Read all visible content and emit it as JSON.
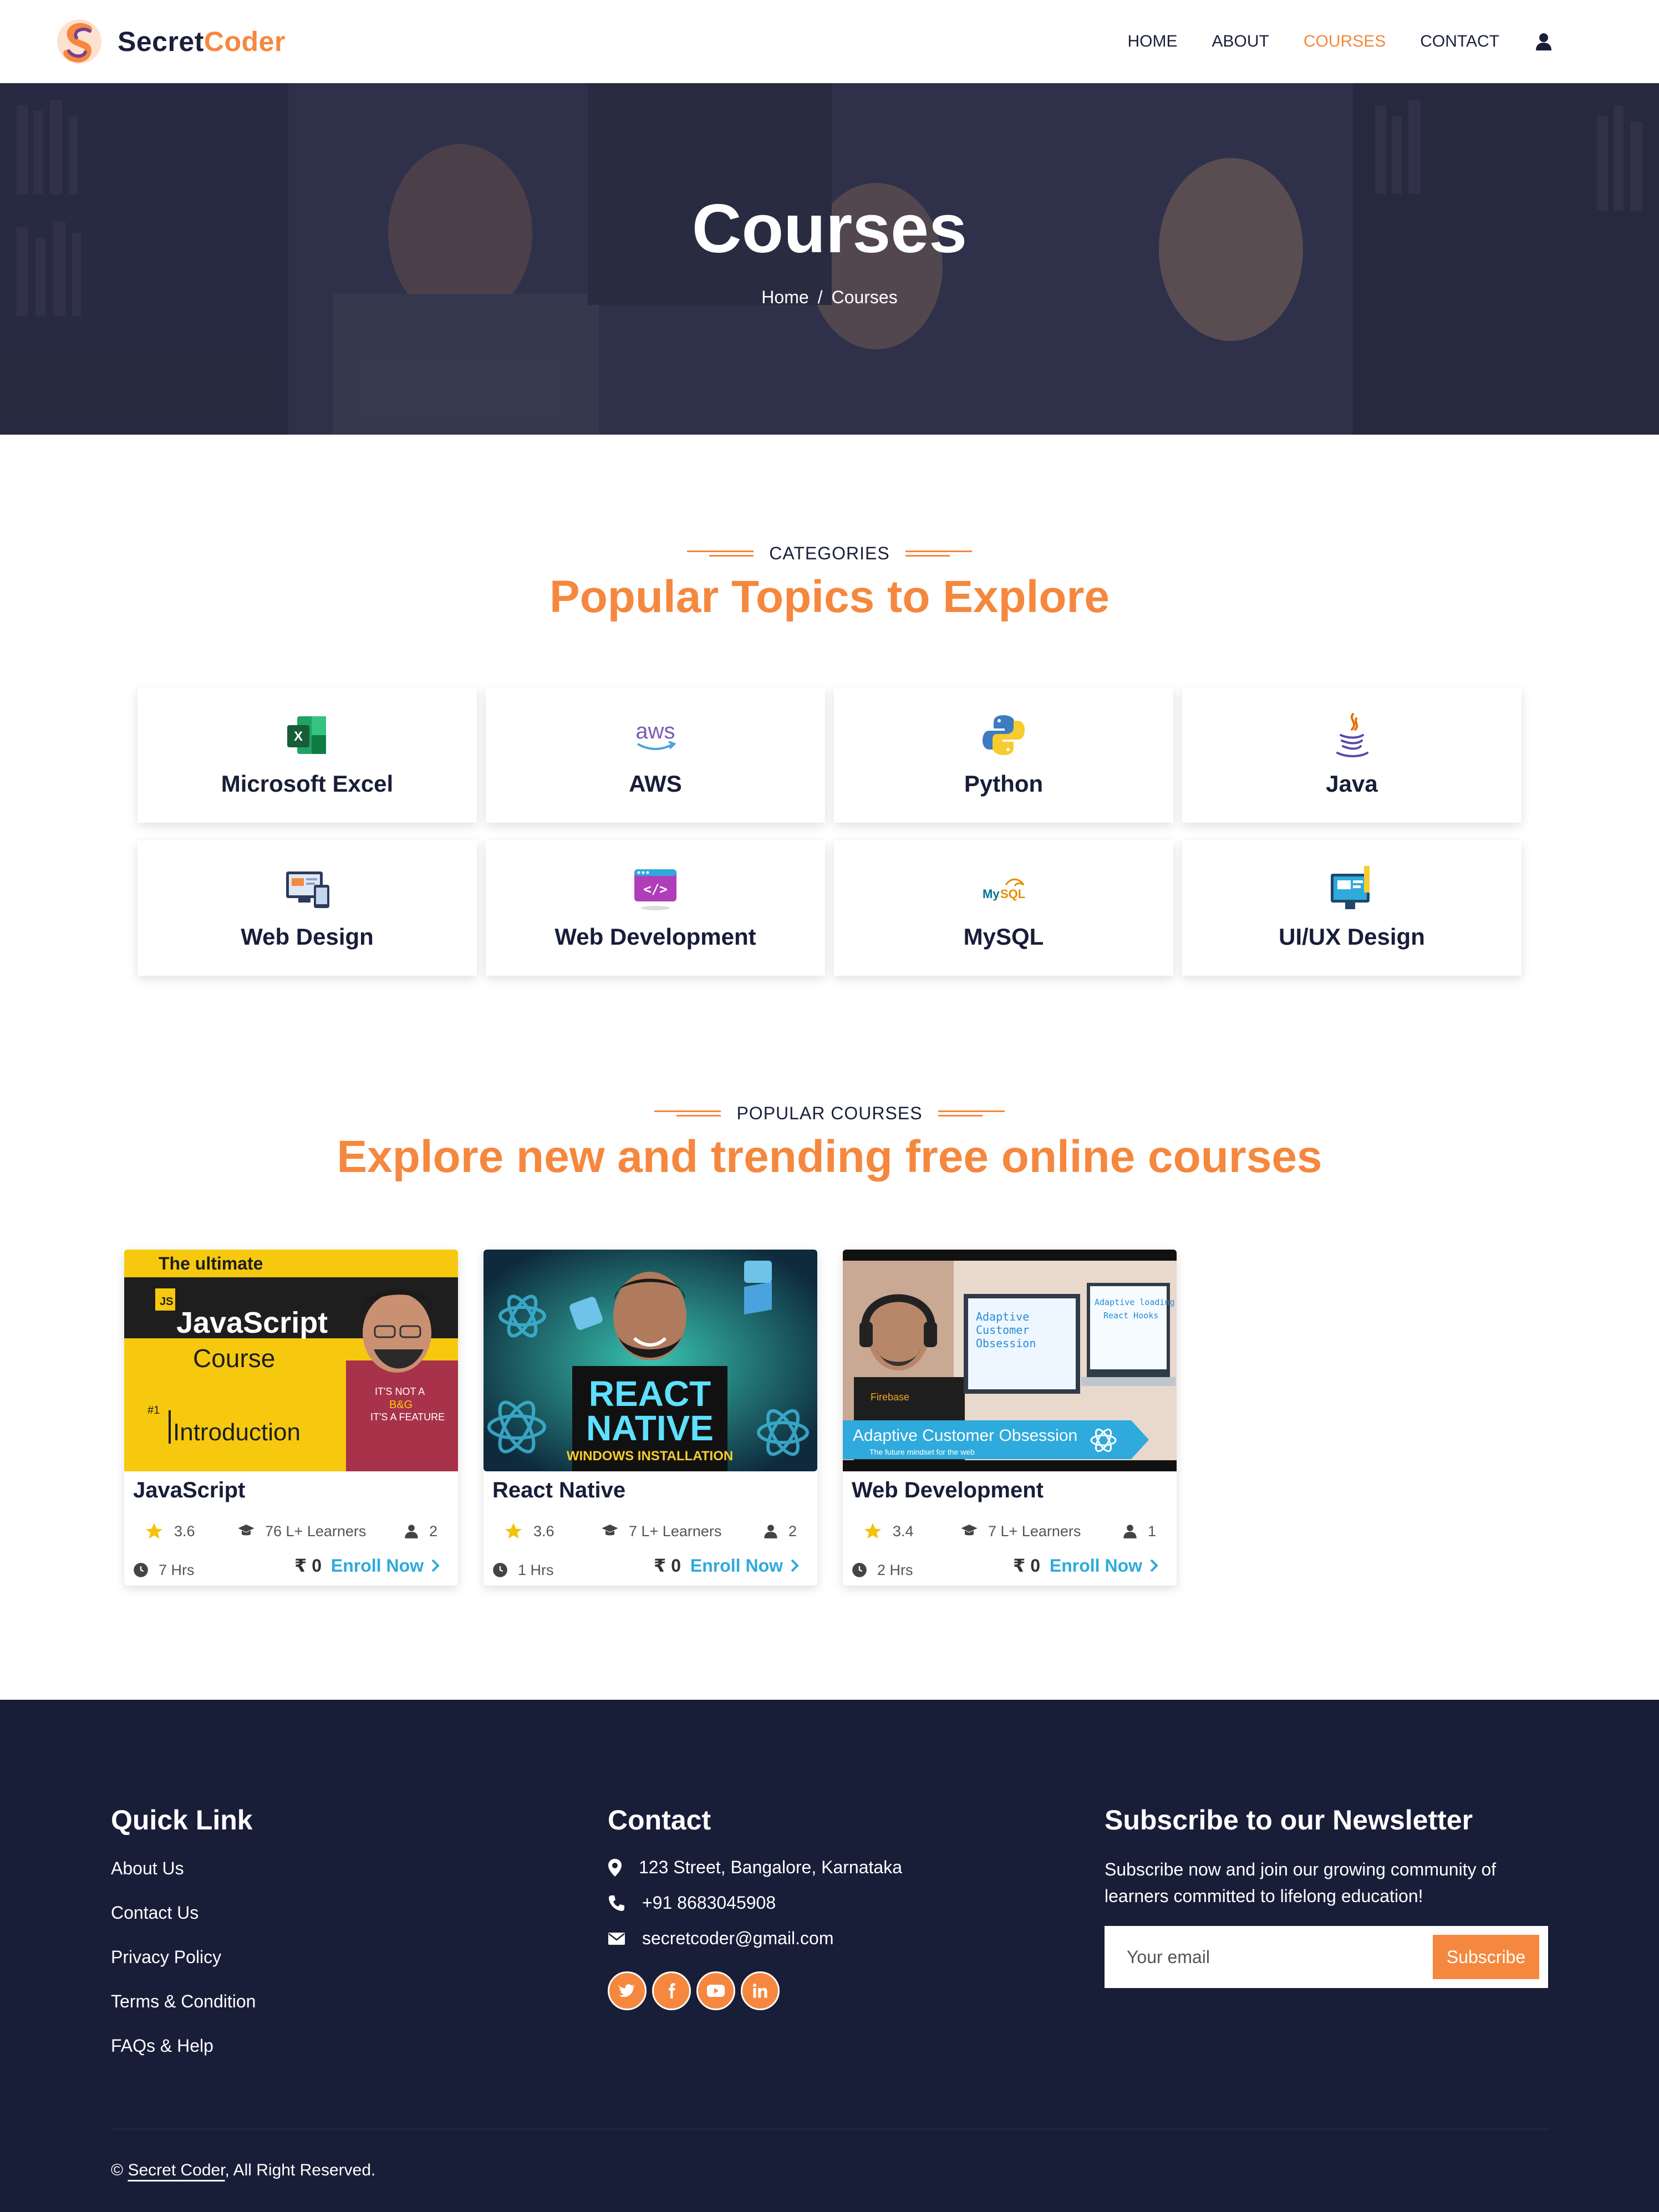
{
  "brand": {
    "name_part1": "Secret",
    "name_part2": "Coder"
  },
  "nav": {
    "items": [
      {
        "label": "HOME",
        "active": false
      },
      {
        "label": "ABOUT",
        "active": false
      },
      {
        "label": "COURSES",
        "active": true
      },
      {
        "label": "CONTACT",
        "active": false
      }
    ],
    "user_icon": "user-icon"
  },
  "hero": {
    "title": "Courses",
    "breadcrumb_home": "Home",
    "breadcrumb_sep": "/",
    "breadcrumb_current": "Courses"
  },
  "categories_section": {
    "kicker": "CATEGORIES",
    "title": "Popular Topics to Explore",
    "items": [
      {
        "name": "Microsoft Excel",
        "icon": "excel-icon"
      },
      {
        "name": "AWS",
        "icon": "aws-icon"
      },
      {
        "name": "Python",
        "icon": "python-icon"
      },
      {
        "name": "Java",
        "icon": "java-icon"
      },
      {
        "name": "Web Design",
        "icon": "web-design-icon"
      },
      {
        "name": "Web Development",
        "icon": "web-development-icon"
      },
      {
        "name": "MySQL",
        "icon": "mysql-icon"
      },
      {
        "name": "UI/UX Design",
        "icon": "uiux-icon"
      }
    ]
  },
  "courses_section": {
    "kicker": "POPULAR COURSES",
    "title": "Explore new and trending free online courses",
    "courses": [
      {
        "name": "JavaScript",
        "rating": "3.6",
        "learners": "76 L+ Learners",
        "instructors": "2",
        "duration": "7 Hrs",
        "price": "₹ 0",
        "enroll": "Enroll Now",
        "thumb": {
          "top": "The ultimate",
          "badge": "JS",
          "line1": "JavaScript",
          "line2": "Course",
          "num": "#1",
          "line3": "Introduction",
          "shirt1": "IT'S NOT A",
          "shirt2": "B&G",
          "shirt3": "IT'S A FEATURE"
        }
      },
      {
        "name": "React Native",
        "rating": "3.6",
        "learners": "7 L+ Learners",
        "instructors": "2",
        "duration": "1 Hrs",
        "price": "₹ 0",
        "enroll": "Enroll Now",
        "thumb": {
          "line1": "REACT",
          "line2": "NATIVE",
          "line3": "WINDOWS INSTALLATION"
        }
      },
      {
        "name": "Web Development",
        "rating": "3.4",
        "learners": "7 L+ Learners",
        "instructors": "1",
        "duration": "2 Hrs",
        "price": "₹ 0",
        "enroll": "Enroll Now",
        "thumb": {
          "banner": "Adaptive Customer Obsession",
          "sub": "The future mindset for the web",
          "screen1a": "Adaptive",
          "screen1b": "Customer",
          "screen1c": "Obsession",
          "screen2a": "Adaptive loading",
          "screen2b": "React Hooks",
          "tag": "Firebase"
        }
      }
    ]
  },
  "footer": {
    "quick_title": "Quick Link",
    "quick_links": [
      "About Us",
      "Contact Us",
      "Privacy Policy",
      "Terms & Condition",
      "FAQs & Help"
    ],
    "contact_title": "Contact",
    "address": "123 Street, Bangalore, Karnataka",
    "phone": "+91 8683045908",
    "email": "secretcoder@gmail.com",
    "socials": [
      "twitter-icon",
      "facebook-icon",
      "youtube-icon",
      "linkedin-icon"
    ],
    "newsletter_title": "Subscribe to our Newsletter",
    "newsletter_text": "Subscribe now and join our growing community of learners committed to lifelong education!",
    "email_placeholder": "Your email",
    "subscribe_label": "Subscribe",
    "copyright_prefix": "©",
    "copyright_brand": "Secret Coder",
    "copyright_suffix": ", All Right Reserved."
  },
  "colors": {
    "accent": "#f5883e",
    "dark": "#181d38",
    "link": "#2eaadc",
    "star": "#f4c20d"
  }
}
